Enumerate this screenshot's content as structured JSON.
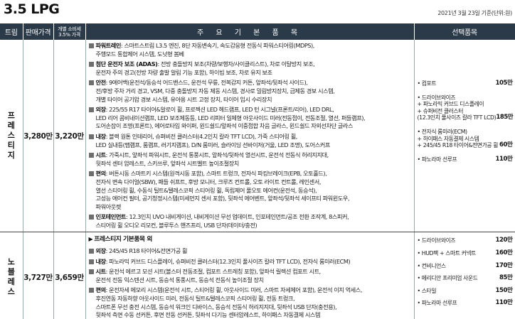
{
  "title": "3.5 LPG",
  "date_note": "2021년 3월 23일 기준(단위:원)",
  "headers": {
    "trim": "트림",
    "price": "판매가격",
    "ind_line1": "개별 소비세",
    "ind_line2": "3.5% 가격",
    "main": "주 요 기 본 품 목",
    "options": "선택품목"
  },
  "rows": [
    {
      "trim_chars": [
        "프",
        "레",
        "스",
        "티",
        "지"
      ],
      "price": "3,280만",
      "ind_price": "3,220만",
      "sections": [
        {
          "label": "파워트레인",
          "lines": [
            ": 스마트스트림 L3.5 엔진, 8단 자동변속기, 속도감응형 전동식 파워스티어링(MDPS),",
            "주행모드 통합제어 시스템, 도넛형 봄베"
          ]
        },
        {
          "label": "첨단 운전자 보조 (ADAS)",
          "lines": [
            ": 전방 충돌방지 보조(차량/보행자/사이클리스트), 차로 이탈방지 보조,",
            "운전자 주의 경고(전방 차량 출발 알림 기능 포함), 하이빔 보조, 차로 유지 보조"
          ]
        },
        {
          "label": "안전",
          "lines": [
            ": 9에어백(운전석/동승석 어드밴스드, 운전석 무릎, 전복감지 커튼, 앞좌석/뒷좌석 사이드),",
            "전/후방 주차 거리 경고, VSM, 다중 충돌방지 자동 제동 시스템, 경사로 밀림방지장치, 급제동 경보 시스템,",
            "개별 타이어 공기압 경보 시스템, 유아용 시트 고정 장치, 타이어 임시 수리장치"
          ]
        },
        {
          "label": "외장",
          "lines": [
            ": 225/55 R17 타이어&알로이 휠, 프로젝션 LED 헤드램프, LED 턴 시그널(프론트/리어), LED DRL,",
            "LED 리어 콤비네이션램프, LED 보조제동등, LED 리피터 일체형 아웃사이드 미러(전동접이, 전동조절, 열선, 퍼들램프),",
            "도어손잡이 조명(프론트), 에어로타입 와이퍼, 윈드쉴드/앞좌석 이중접합 차음 글라스, 윈드쉴드 자외선차단 글라스"
          ]
        },
        {
          "label": "내장",
          "lines": [
            ": 블랙 원톤 인테리어, 슈퍼비전 클러스터(4.2인치 칼라 TFT LCD), 가죽 스티어링 휠,",
            "LED 실내등(맵램프, 룸램프, 러기지램프), D/N 룸미러, 슬라이딩 선바이저(거울, LED 조명), 도어스커프"
          ]
        },
        {
          "label": "시트",
          "lines": [
            ": 가죽시트, 앞좌석 파워시트, 운전석 통풍시트, 앞좌석/뒷좌석 열선시트, 운전석 전동식 허리지지대,",
            "뒷좌석 센터 암레스트, 스키쓰루, 앞좌석 시트벨트 높이조절장치"
          ]
        },
        {
          "label": "편의",
          "lines": [
            ": 버튼시동 스마트키 시스템(원격시동 포함), 스마트 트렁크, 전자식 파킹브레이크(EPB, 오토홀드),",
            "전자식 변속 다이얼(SBW), 패들 쉬프트, 후방 모니터, 크루즈 컨트롤, 오토 라이트 컨트롤, 레인센서,",
            "열선 스티어링 휠, 수동식 틸트&텔레스코픽 스티어링 휠, 독립제어 풀오토 에어컨(운전석, 동승석),",
            "고성능 에어컨 필터, 공기청정시스템(미세먼지 센서 포함), 뒷좌석 에어벤트, 앞좌석/뒷좌석 세이프티 파워윈도우,",
            "파워아웃렛"
          ]
        },
        {
          "label": "인포테인먼트",
          "lines": [
            ": 12.3인치 UVO 내비게이션, 내비게이션 무선 업데이트, 인포테인먼트/공조 전환 조작계, 8스피커,",
            "스티어링 휠 오디오 리모컨, 블루투스 핸즈프리, USB 단자(데이터/충전)"
          ]
        }
      ],
      "options": [
        {
          "lines": [
            "• 컴포트"
          ],
          "price": "105만"
        },
        {
          "lines": [
            "• 드라이브와이즈",
            "+ 파노라믹 커브드 디스플레이",
            "+ 슈퍼비전 클러스터",
            "(12.3인치 풀사이즈 칼라 TFT LCD)"
          ],
          "price": "185만"
        },
        {
          "lines": [
            "• 전자식 룸미러(ECM)",
            "+ 하이패스 자동결제 시스템",
            "+ 245/45 R18 타이어&전면가공 휠"
          ],
          "price": "60만"
        },
        {
          "lines": [
            "• 파노라마 선루프"
          ],
          "price": "110만"
        }
      ]
    },
    {
      "trim_chars": [
        "노",
        "블",
        "레",
        "스"
      ],
      "price": "3,727만",
      "ind_price": "3,659만",
      "base_head": "프레스티지 기본품목 외",
      "sections": [
        {
          "label": "외장",
          "lines": [
            ": 245/45 R18 타이어&전면가공 휠"
          ]
        },
        {
          "label": "내장",
          "lines": [
            ": 파노라믹 커브드 디스플레이, 슈퍼비전 클러스터(12.3인치 풀사이즈 칼라 TFT LCD), 전자식 룸미러(ECM)"
          ]
        },
        {
          "label": "시트",
          "lines": [
            ": 운전석 에르고 모션 시트(볼스터 전동조절, 컴포트 스트레칭 포함), 앞좌석 릴렉션 컴포트 시트,",
            "운전석 전동 익스텐션 시트, 동승석 통풍시트, 동승석 전동식 높이조절 장치"
          ]
        },
        {
          "label": "편의",
          "lines": [
            ": 운전자세 메모리 시스템(운전석 시트, 스티어링 휠, 아웃사이드 미러, 스마트 자세제어 포함), 운전석 이지 억세스,",
            "후진연동 자동하향 아웃사이드 미러, 전동식 틸트&텔레스코픽 스티어링 휠, 전동 트렁크,",
            "스마트폰 무선 충전 시스템, 동승석 워크인 디바이스, 동승석 전동식 허리지지대, 뒷좌석 USB 단자(충전용),",
            "뒷좌석 측면 수동 선커튼, 후면 전동 선커튼, 뒷좌석 다기능 센터암레스트, 하이패스 자동결제 시스템"
          ]
        }
      ],
      "options": [
        {
          "lines": [
            "• 드라이브와이즈"
          ],
          "price": "120만"
        },
        {
          "lines": [
            "• HUD팩 + 스마트 커넥트"
          ],
          "price": "160만"
        },
        {
          "lines": [
            "• 컨비니언스"
          ],
          "price": "170만"
        },
        {
          "lines": [
            "• 메리디안 프리미엄 사운드"
          ],
          "price": "85만"
        },
        {
          "lines": [
            "• 스타일"
          ],
          "price": "150만"
        },
        {
          "lines": [
            "• 파노라마 선루프"
          ],
          "price": "110만"
        }
      ]
    }
  ]
}
